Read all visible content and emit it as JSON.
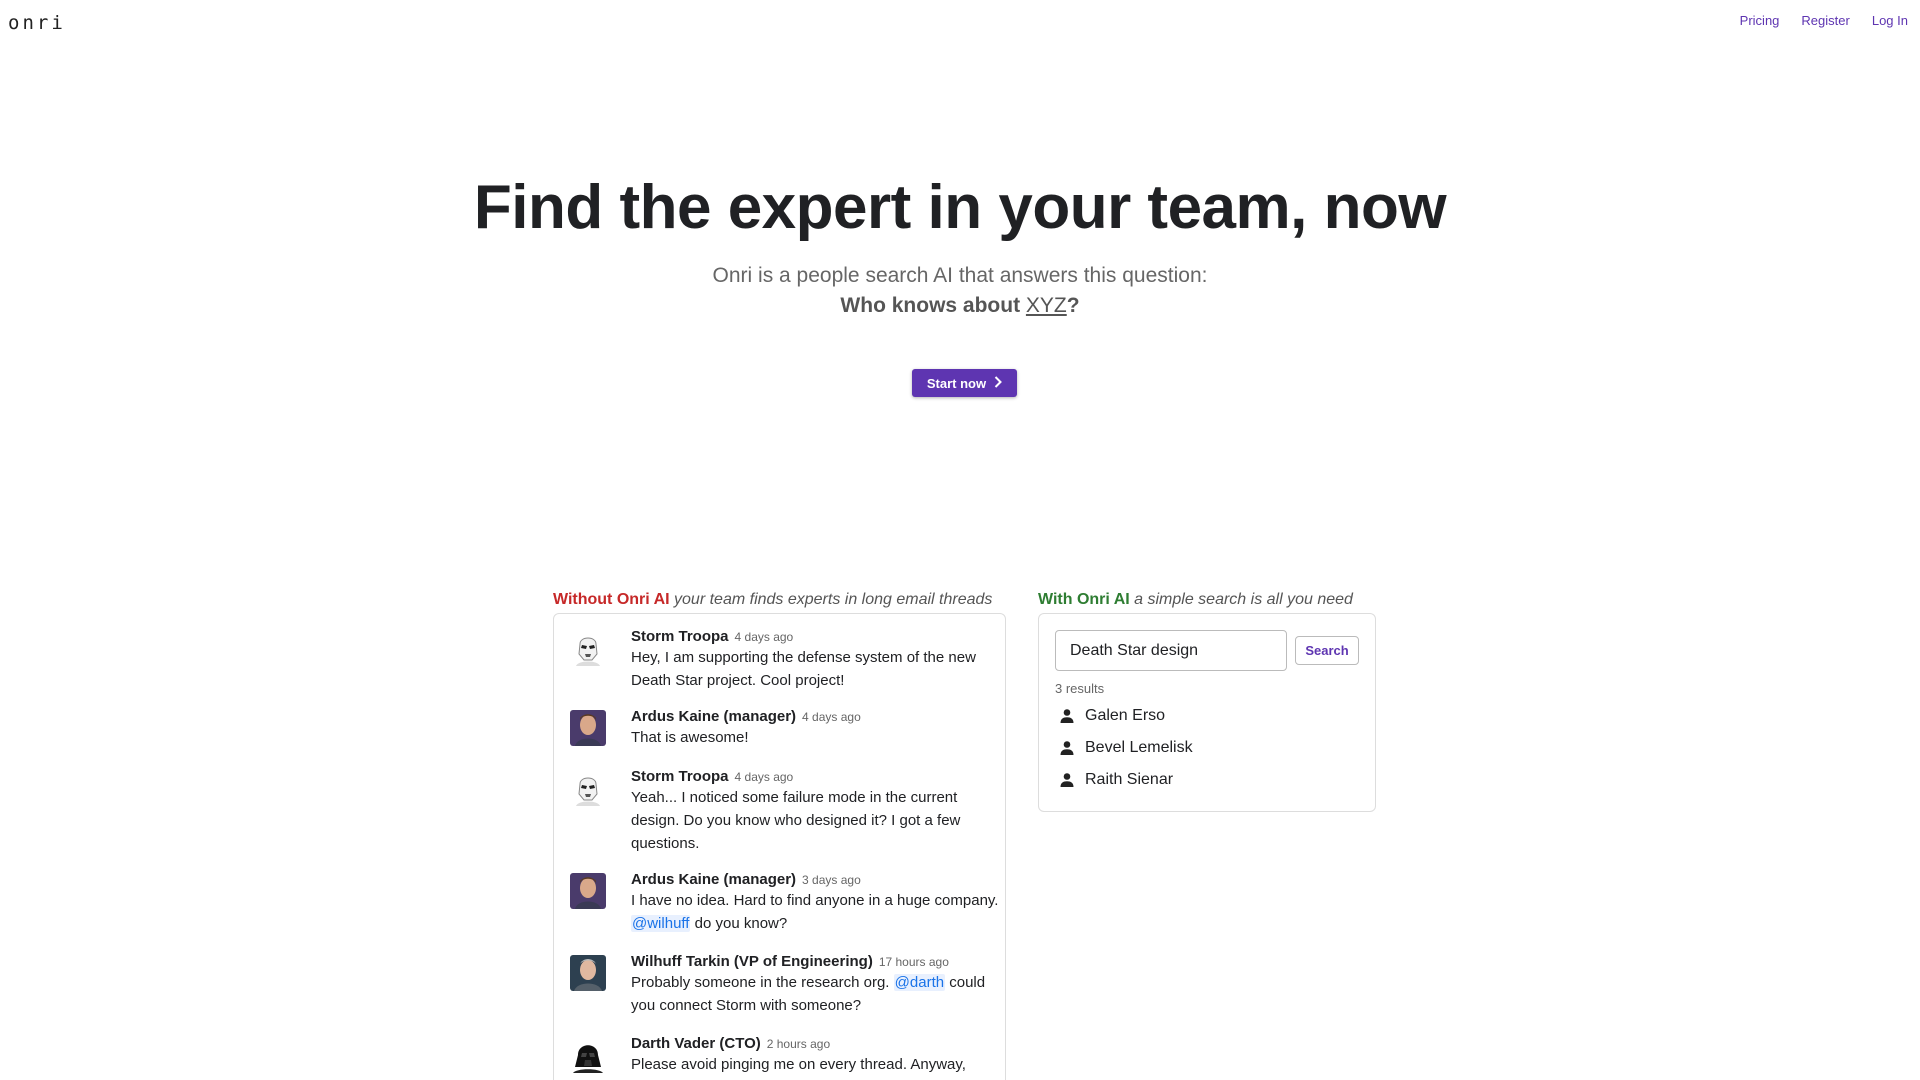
{
  "header": {
    "logo": "onri",
    "nav": [
      "Pricing",
      "Register",
      "Log In"
    ]
  },
  "hero": {
    "title": "Find the expert in your team, now",
    "subtitle": "Onri is a people search AI that answers this question:",
    "question_prefix": "Who knows about ",
    "question_topic": "XYZ",
    "question_suffix": "?",
    "cta_label": "Start now"
  },
  "without": {
    "label_strong": "Without Onri AI",
    "label_rest": "your team finds experts in long email threads",
    "messages": [
      {
        "author": "Storm Troopa",
        "time": "4 days ago",
        "avatar": "stormtrooper-avatar",
        "parts": [
          {
            "t": "Hey, I am supporting the defense system of the new Death Star project. Cool project!"
          }
        ]
      },
      {
        "author": "Ardus Kaine (manager)",
        "time": "4 days ago",
        "avatar": "manager-avatar",
        "parts": [
          {
            "t": "That is awesome!"
          }
        ]
      },
      {
        "author": "Storm Troopa",
        "time": "4 days ago",
        "avatar": "stormtrooper-avatar",
        "parts": [
          {
            "t": "Yeah... I noticed some failure mode in the current design. Do you know who designed it? I got a few questions."
          }
        ]
      },
      {
        "author": "Ardus Kaine (manager)",
        "time": "3 days ago",
        "avatar": "manager-avatar",
        "parts": [
          {
            "t": "I have no idea. Hard to find anyone in a huge company. "
          },
          {
            "m": "@wilhuff"
          },
          {
            "t": " do you know?"
          }
        ]
      },
      {
        "author": "Wilhuff Tarkin (VP of Engineering)",
        "time": "17 hours ago",
        "avatar": "vp-avatar",
        "parts": [
          {
            "t": "Probably someone in the research org. "
          },
          {
            "m": "@darth"
          },
          {
            "t": " could you connect Storm with someone?"
          }
        ]
      },
      {
        "author": "Darth Vader (CTO)",
        "time": "2 hours ago",
        "avatar": "vader-avatar",
        "parts": [
          {
            "t": "Please avoid pinging me on every thread. Anyway, Galen is the person you're looking for."
          }
        ]
      }
    ]
  },
  "with": {
    "label_strong": "With Onri AI",
    "label_rest": "a simple search is all you need",
    "search_value": "Death Star design",
    "search_button": "Search",
    "result_count": "3 results",
    "results": [
      "Galen Erso",
      "Bevel Lemelisk",
      "Raith Sienar"
    ]
  },
  "colors": {
    "accent": "#5e35b1",
    "without": "#c62828",
    "with": "#2e7d32",
    "mention": "#1a73e8"
  }
}
